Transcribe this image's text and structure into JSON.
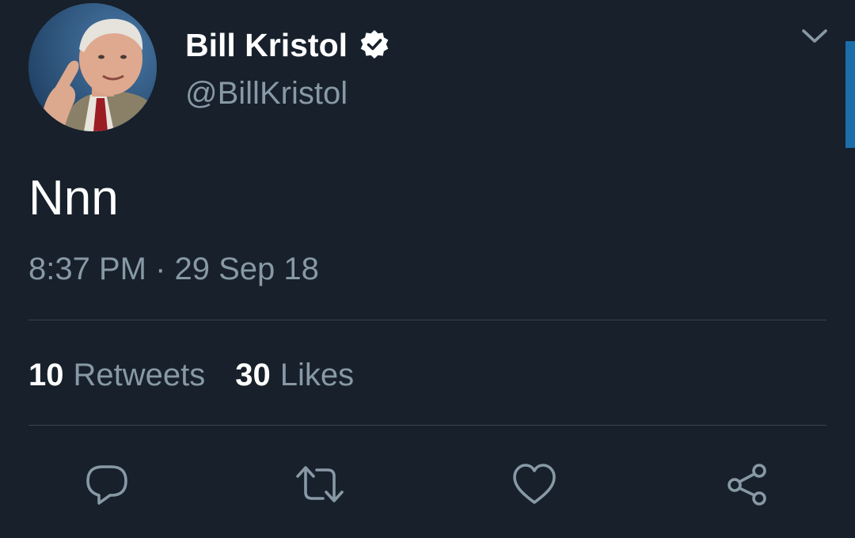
{
  "colors": {
    "background": "#17202b",
    "primary_text": "#ffffff",
    "secondary_text": "#8899a6",
    "divider": "#38444d",
    "accent": "#1c6ea8"
  },
  "author": {
    "display_name": "Bill Kristol",
    "handle": "@BillKristol",
    "verified": true,
    "avatar_icon": "profile-photo"
  },
  "tweet": {
    "text": "Nnn",
    "timestamp": "8:37 PM · 29 Sep 18"
  },
  "stats": {
    "retweets_count": "10",
    "retweets_label": "Retweets",
    "likes_count": "30",
    "likes_label": "Likes"
  },
  "actions": [
    {
      "name": "reply",
      "icon": "speech-bubble-icon"
    },
    {
      "name": "retweet",
      "icon": "retweet-arrows-icon"
    },
    {
      "name": "like",
      "icon": "heart-icon"
    },
    {
      "name": "share",
      "icon": "share-nodes-icon"
    }
  ],
  "menu_icon": "chevron-down-icon"
}
